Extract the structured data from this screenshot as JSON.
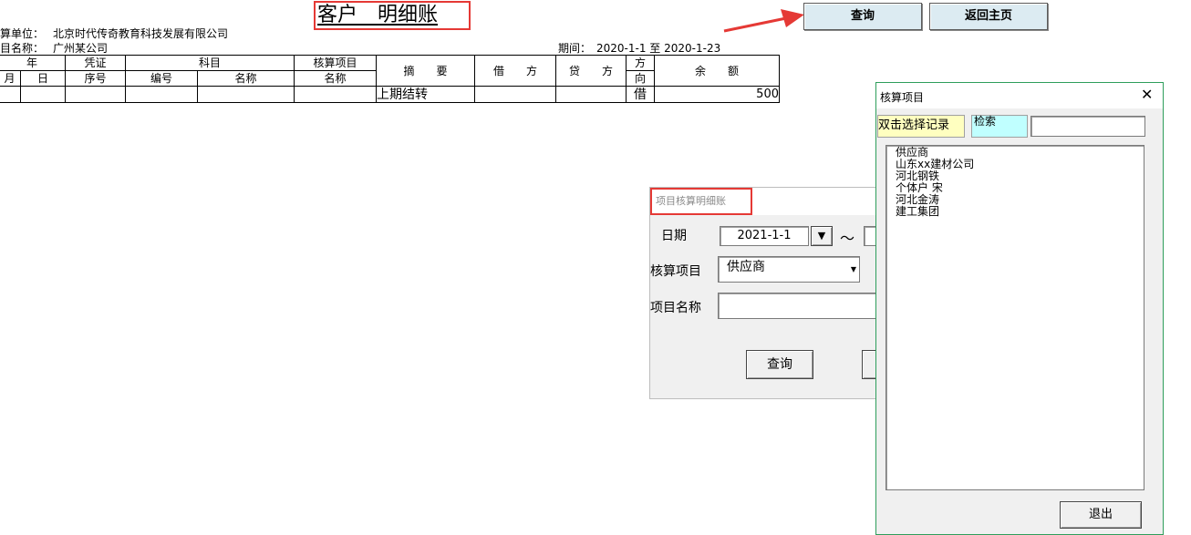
{
  "sheet": {
    "title": "客户　明细账",
    "unit_label": "算单位：",
    "unit_value": "北京时代传奇教育科技发展有限公司",
    "item_label": "目名称：",
    "item_value": "广州某公司",
    "period_label": "期间：",
    "period_value": "2020-1-1 至 2020-1-23"
  },
  "top_buttons": {
    "query": "查询",
    "home": "返回主页"
  },
  "ledger": {
    "headers": {
      "year": "年",
      "voucher": "凭证",
      "voucher_seq": "序号",
      "subject": "科目",
      "calc_item": "核算项目",
      "summary": "摘　　要",
      "debit": "借　　方",
      "credit": "贷　　方",
      "direction_1": "方",
      "direction_2": "向",
      "balance": "余　　额",
      "month": "月",
      "day": "日",
      "code": "编号",
      "name": "名称",
      "calc_name": "名称"
    },
    "rows": [
      {
        "summary": "上期结转",
        "direction": "借",
        "balance": "500"
      }
    ]
  },
  "dialog_detail": {
    "title": "项目核算明细账",
    "date_label": "日期",
    "date_from": "2021-1-1",
    "tilde": "～",
    "calc_item_label": "核算项目",
    "calc_item_value": "供应商",
    "item_name_label": "项目名称",
    "query_button": "查询"
  },
  "dialog_picker": {
    "title": "核算项目",
    "hint": "双击选择记录",
    "search_label": "检索",
    "items": [
      "供应商",
      "山东xx建材公司",
      "河北钢铁",
      "个体户 宋",
      "河北金涛",
      "建工集团"
    ],
    "exit_button": "退出"
  },
  "colors": {
    "accent_red": "#e53935",
    "button_blue": "#dcebf2",
    "hint_yellow": "#ffffc0",
    "search_cyan": "#c0ffff",
    "dialog_green": "#2e9e5b"
  }
}
